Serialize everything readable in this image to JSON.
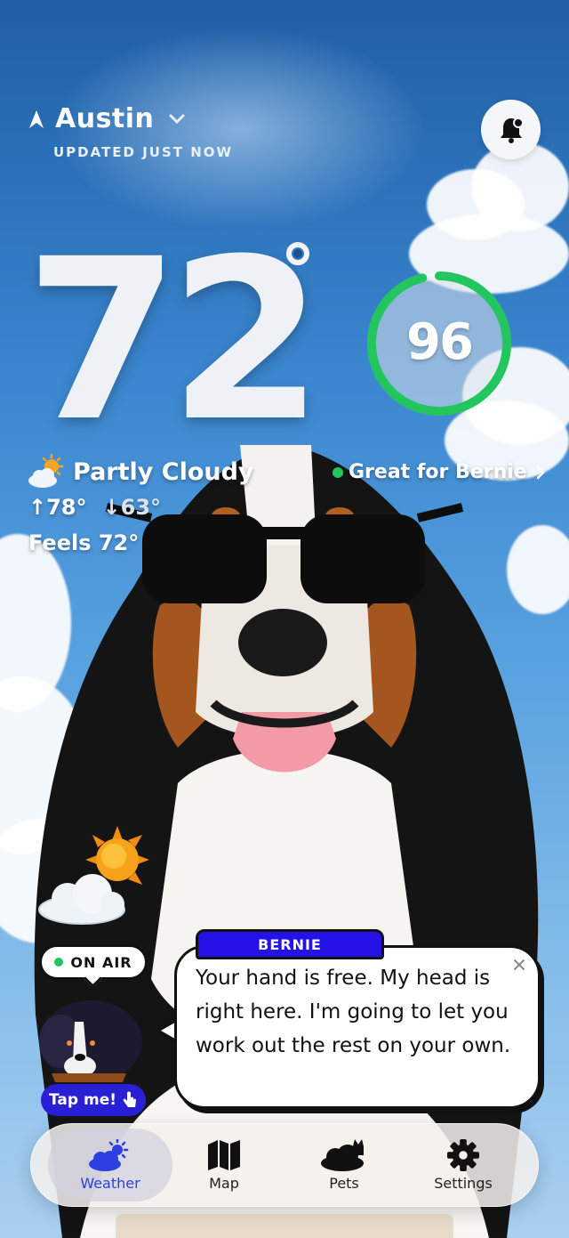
{
  "header": {
    "city": "Austin",
    "updated": "UPDATED JUST NOW"
  },
  "weather": {
    "temperature": "72",
    "condition": "Partly Cloudy",
    "high": "78°",
    "low": "63°",
    "feels_like": "Feels 72°"
  },
  "pet_score": {
    "value": "96",
    "fraction": 0.96,
    "status": "Great for Bernie",
    "ring_color": "#22c55e"
  },
  "companion": {
    "on_air": "ON AIR",
    "tap_label": "Tap me!",
    "name": "BERNIE",
    "message": "Your hand is free. My head is right here. I'm going to let you work out the rest on your own."
  },
  "tabs": [
    {
      "label": "Weather",
      "icon": "weather-icon",
      "active": true
    },
    {
      "label": "Map",
      "icon": "map-icon",
      "active": false
    },
    {
      "label": "Pets",
      "icon": "pets-icon",
      "active": false
    },
    {
      "label": "Settings",
      "icon": "gear-icon",
      "active": false
    }
  ],
  "colors": {
    "accent": "#2c3fe0",
    "bubble_header": "#2412e8",
    "status_green": "#22c55e"
  }
}
